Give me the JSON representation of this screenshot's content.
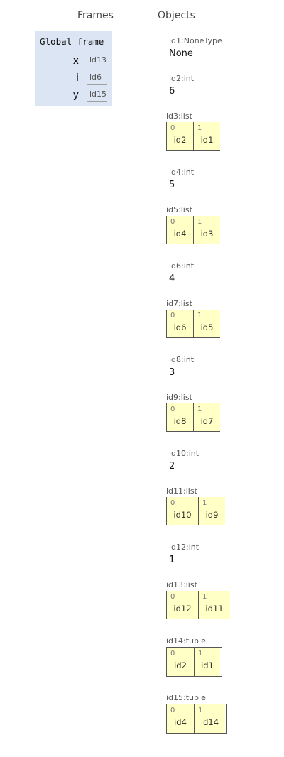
{
  "headings": {
    "frames": "Frames",
    "objects": "Objects"
  },
  "frame": {
    "title": "Global frame",
    "vars": [
      {
        "name": "x",
        "value": "id13"
      },
      {
        "name": "i",
        "value": "id6"
      },
      {
        "name": "y",
        "value": "id15"
      }
    ]
  },
  "objects": {
    "id1": {
      "label": "id1:NoneType",
      "value": "None"
    },
    "id2": {
      "label": "id2:int",
      "value": "6"
    },
    "id3": {
      "label": "id3:list",
      "items": [
        {
          "index": "0",
          "ref": "id2"
        },
        {
          "index": "1",
          "ref": "id1"
        }
      ]
    },
    "id4": {
      "label": "id4:int",
      "value": "5"
    },
    "id5": {
      "label": "id5:list",
      "items": [
        {
          "index": "0",
          "ref": "id4"
        },
        {
          "index": "1",
          "ref": "id3"
        }
      ]
    },
    "id6": {
      "label": "id6:int",
      "value": "4"
    },
    "id7": {
      "label": "id7:list",
      "items": [
        {
          "index": "0",
          "ref": "id6"
        },
        {
          "index": "1",
          "ref": "id5"
        }
      ]
    },
    "id8": {
      "label": "id8:int",
      "value": "3"
    },
    "id9": {
      "label": "id9:list",
      "items": [
        {
          "index": "0",
          "ref": "id8"
        },
        {
          "index": "1",
          "ref": "id7"
        }
      ]
    },
    "id10": {
      "label": "id10:int",
      "value": "2"
    },
    "id11": {
      "label": "id11:list",
      "items": [
        {
          "index": "0",
          "ref": "id10"
        },
        {
          "index": "1",
          "ref": "id9"
        }
      ]
    },
    "id12": {
      "label": "id12:int",
      "value": "1"
    },
    "id13": {
      "label": "id13:list",
      "items": [
        {
          "index": "0",
          "ref": "id12"
        },
        {
          "index": "1",
          "ref": "id11"
        }
      ]
    },
    "id14": {
      "label": "id14:tuple",
      "items": [
        {
          "index": "0",
          "ref": "id2"
        },
        {
          "index": "1",
          "ref": "id1"
        }
      ]
    },
    "id15": {
      "label": "id15:tuple",
      "items": [
        {
          "index": "0",
          "ref": "id4"
        },
        {
          "index": "1",
          "ref": "id14"
        }
      ]
    }
  }
}
